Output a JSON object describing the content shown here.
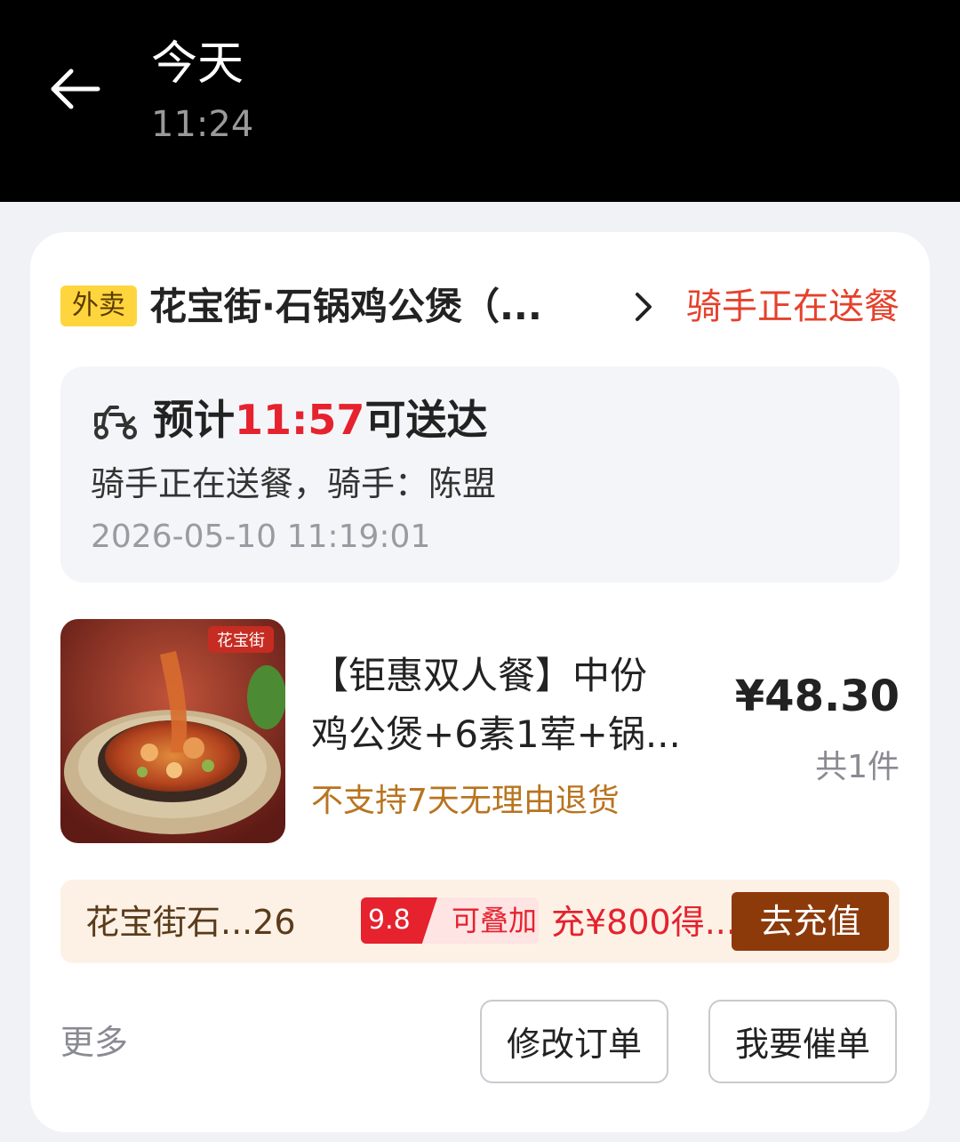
{
  "topbar": {
    "title": "今天",
    "time": "11:24"
  },
  "order": {
    "type_badge": "外卖",
    "shop_name": "花宝街·石锅鸡公煲（...",
    "status": "骑手正在送餐",
    "delivery": {
      "eta_prefix": "预计",
      "eta_time": "11:57",
      "eta_suffix": "可送达",
      "rider_text": "骑手正在送餐，骑手：陈盟",
      "timestamp": "2026-05-10 11:19:01"
    },
    "item": {
      "image_logo": "花宝街",
      "name_line1": "【钜惠双人餐】中份",
      "name_line2": "鸡公煲+6素1荤+锅...",
      "policy": "不支持7天无理由退货",
      "price": "¥48.30",
      "quantity": "共1件"
    },
    "promo": {
      "shop": "花宝街石...26",
      "discount": "9.8",
      "stackable": "可叠加",
      "offer": "充¥800得...",
      "button": "去充值"
    },
    "actions": {
      "more": "更多",
      "modify": "修改订单",
      "urge": "我要催单"
    }
  },
  "colors": {
    "status_red": "#e5412c",
    "eta_red": "#e5222e",
    "badge_yellow": "#ffd53d",
    "policy_brown": "#b8741f",
    "recharge_brown": "#8d3a0b"
  }
}
